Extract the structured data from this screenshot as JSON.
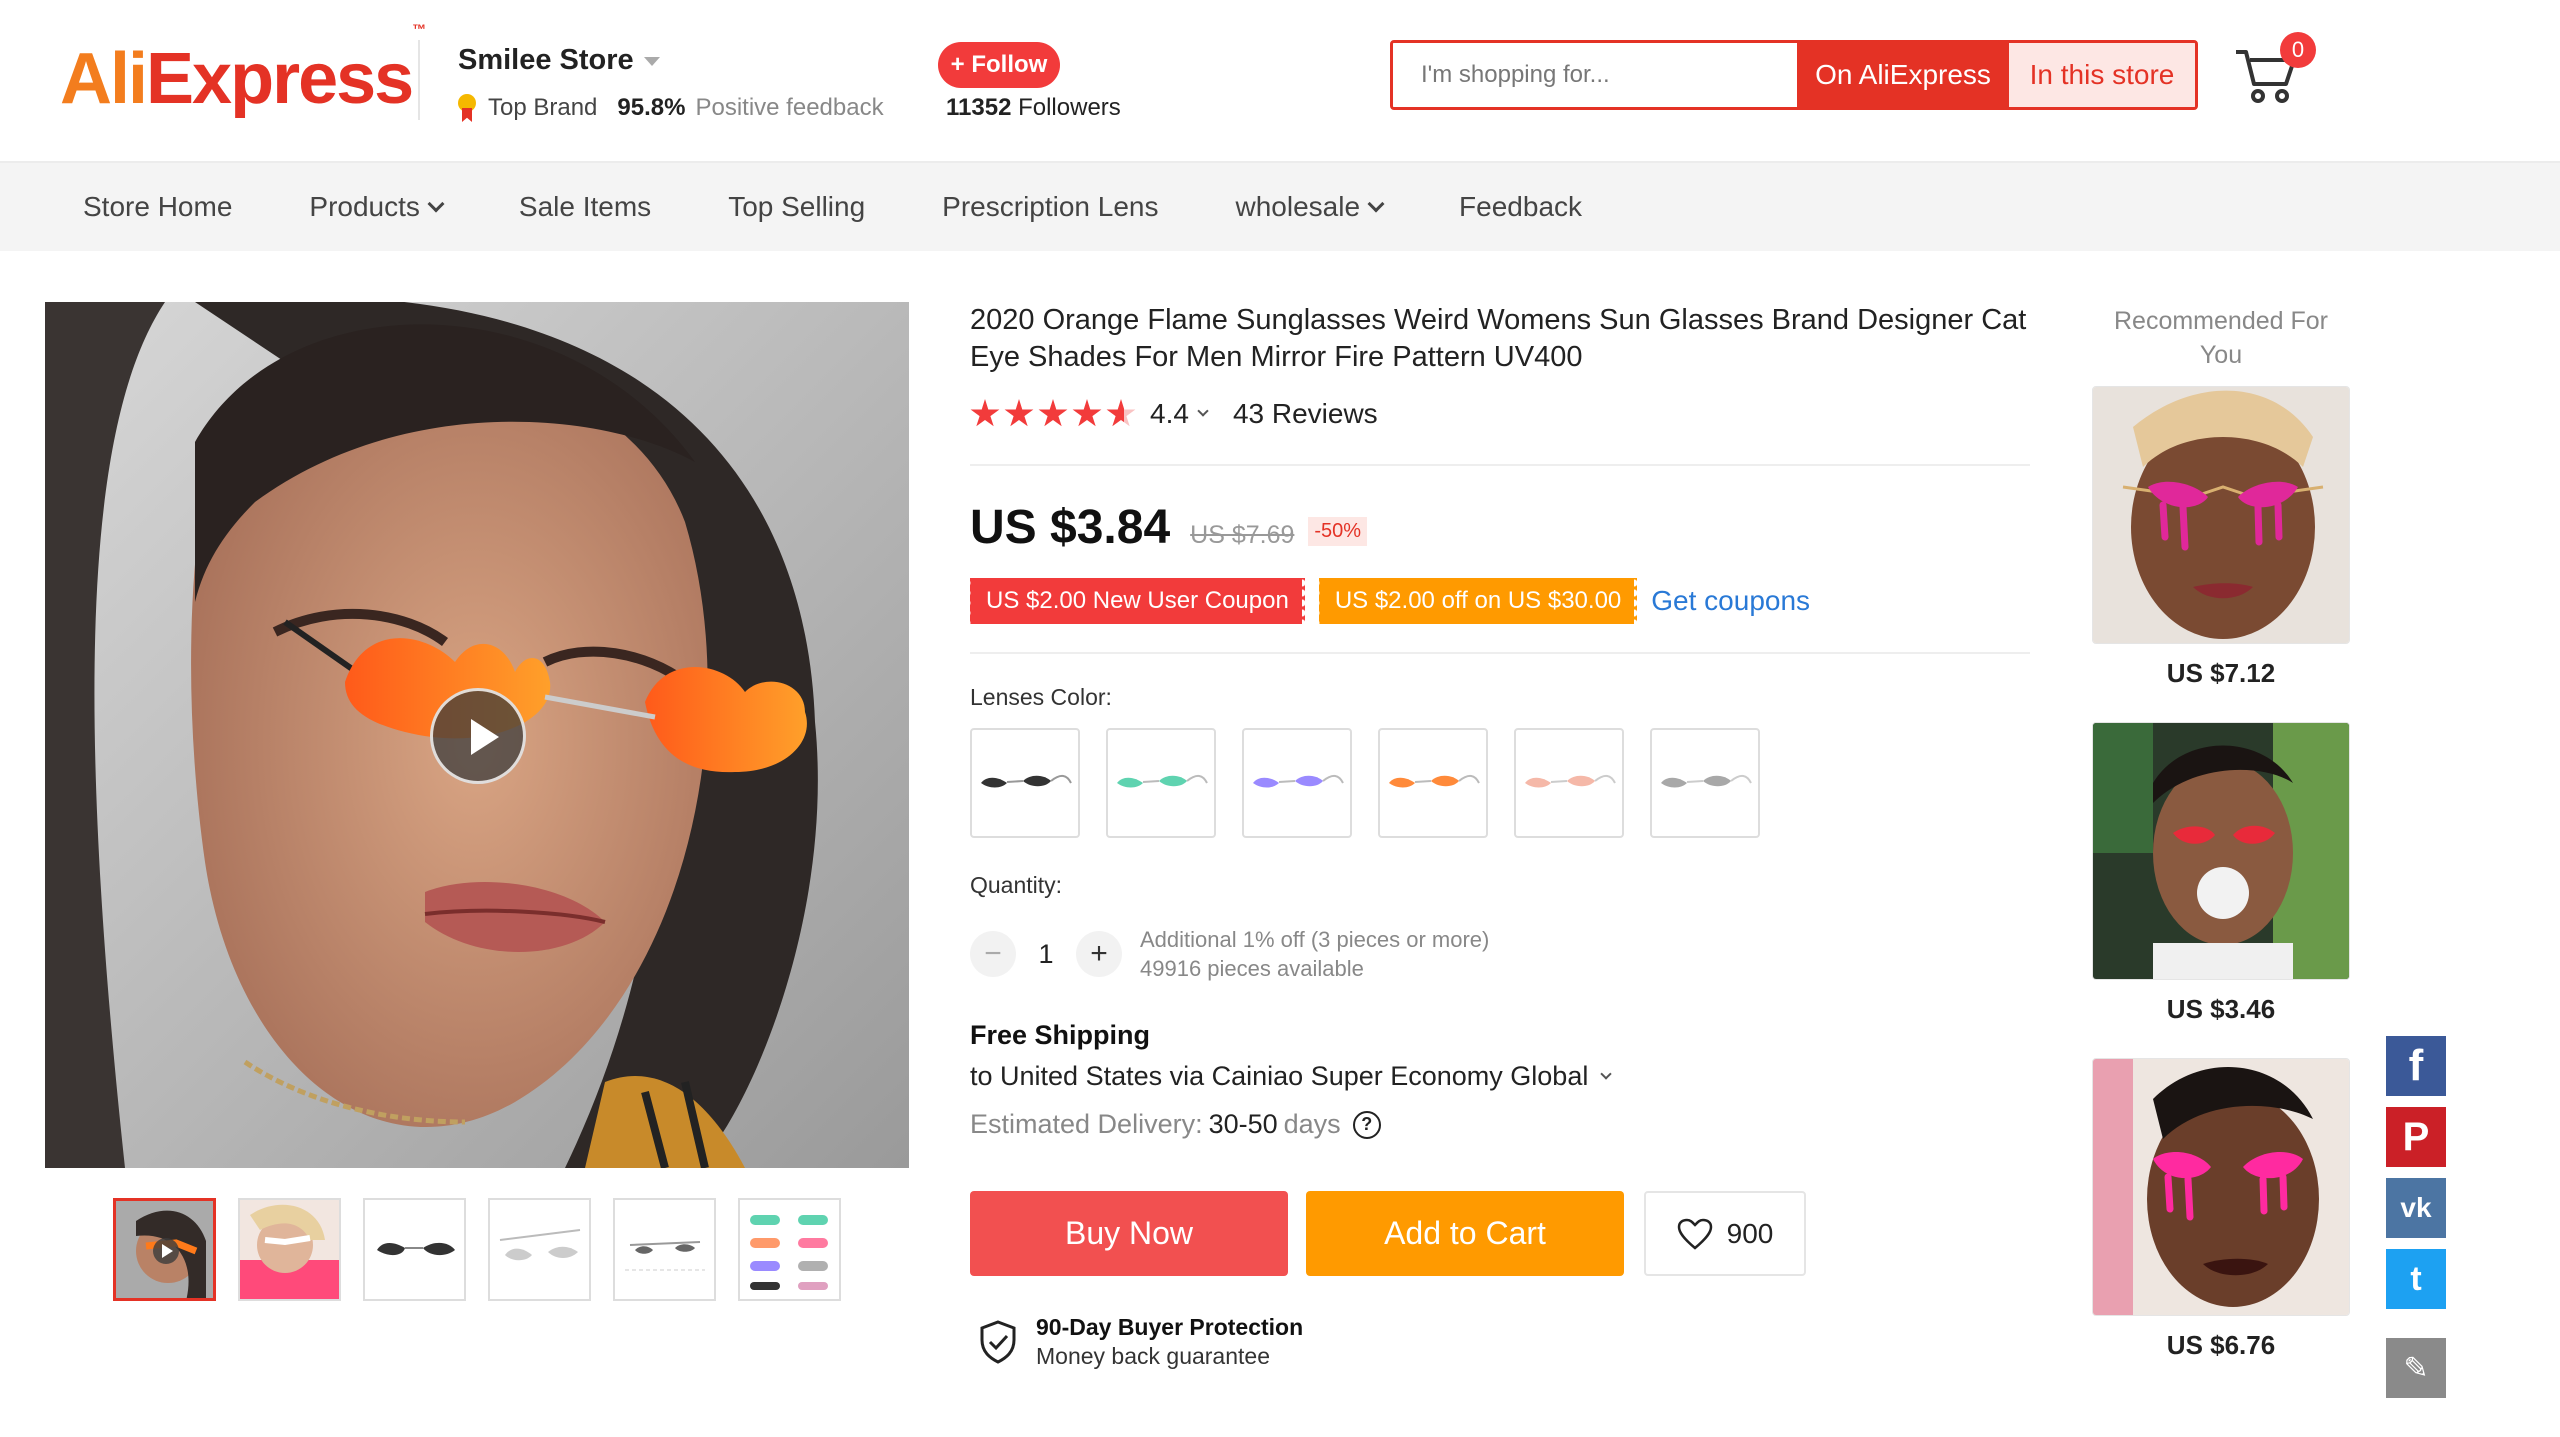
{
  "header": {
    "logo": "AliExpress",
    "store_name": "Smilee Store",
    "top_brand": "Top Brand",
    "positive_pct": "95.8%",
    "positive_label": "Positive feedback",
    "follow_label": "+ Follow",
    "followers_count": "11352",
    "followers_label": "Followers",
    "search_placeholder": "I'm shopping for...",
    "search_on_ali": "On AliExpress",
    "search_in_store": "In this store",
    "cart_count": "0"
  },
  "nav": {
    "items": [
      "Store Home",
      "Products",
      "Sale Items",
      "Top Selling",
      "Prescription Lens",
      "wholesale",
      "Feedback"
    ]
  },
  "product": {
    "title": "2020 Orange Flame Sunglasses Weird Womens Sun Glasses Brand Designer Cat Eye Shades For Men Mirror Fire Pattern UV400",
    "rating": "4.4",
    "rating_stars": 4.4,
    "reviews": "43 Reviews",
    "price": "US $3.84",
    "original_price": "US $7.69",
    "discount": "-50%",
    "coupon1": "US $2.00 New User Coupon",
    "coupon2": "US $2.00 off on US $30.00",
    "get_coupons": "Get coupons",
    "lenses_label": "Lenses Color:",
    "lens_colors": [
      "black-lens",
      "teal-lens",
      "purple-lens",
      "orange-lens",
      "pink-lens",
      "silver-lens"
    ],
    "quantity_label": "Quantity:",
    "quantity_minus": "−",
    "quantity_plus": "+",
    "quantity": "1",
    "qty_discount": "Additional 1% off (3 pieces or more)",
    "qty_available": "49916 pieces available",
    "shipping_title": "Free Shipping",
    "shipping_line": "to United States via Cainiao Super Economy Global",
    "delivery_label": "Estimated Delivery:",
    "delivery_days": "30-50",
    "delivery_unit": "days",
    "buy_now": "Buy Now",
    "add_to_cart": "Add to Cart",
    "wishlist_count": "900",
    "protection_title": "90-Day Buyer Protection",
    "protection_sub": "Money back guarantee"
  },
  "recommended": {
    "title": "Recommended For You",
    "items": [
      {
        "price": "US $7.12"
      },
      {
        "price": "US $3.46"
      },
      {
        "price": "US $6.76"
      }
    ]
  },
  "social": [
    "f",
    "P",
    "vk",
    "t",
    "✎"
  ],
  "colors": {
    "brand_red": "#e43225",
    "brand_orange": "#f37d1e",
    "buy_button": "#f25050",
    "cart_button": "#ff9a00",
    "link_blue": "#2979d6"
  }
}
